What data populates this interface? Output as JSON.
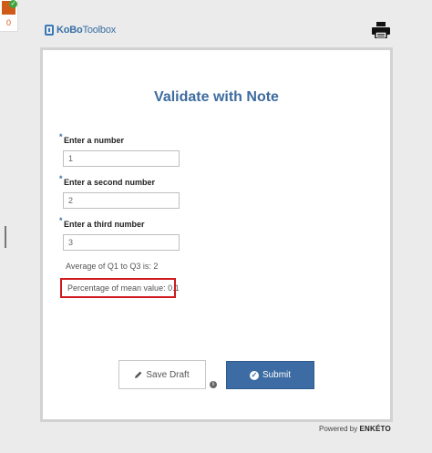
{
  "corner": {
    "count": "0"
  },
  "brand": {
    "name_part1": "KoBo",
    "name_part2": "Toolbox"
  },
  "form": {
    "title": "Validate with Note",
    "questions": [
      {
        "label": "Enter a number",
        "required_marker": "*",
        "value": "1"
      },
      {
        "label": "Enter a second number",
        "required_marker": "*",
        "value": "2"
      },
      {
        "label": "Enter a third number",
        "required_marker": "*",
        "value": "3"
      }
    ],
    "average_note": "Average of Q1 to Q3 is: 2",
    "percentage_note": "Percentage of mean value: 0.1",
    "buttons": {
      "save_draft": "Save Draft",
      "submit": "Submit"
    }
  },
  "footer": {
    "powered_by": "Powered by",
    "engine": "ENKÉTO"
  },
  "icons": {
    "print": "print-icon",
    "pencil": "pencil-icon",
    "check": "check-circle-icon",
    "info": "info-icon"
  },
  "colors": {
    "accent": "#3c6ca3",
    "title": "#3d6c9e",
    "highlight": "#d0191f"
  }
}
